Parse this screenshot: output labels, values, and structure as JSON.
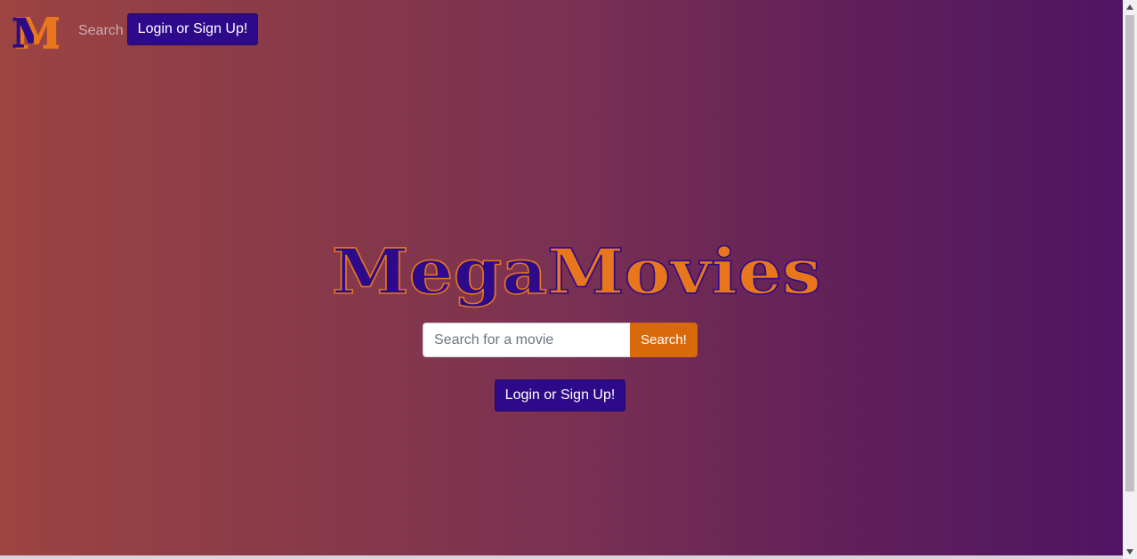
{
  "navbar": {
    "brand_letter": "M",
    "search_link": "Search",
    "login_button": "Login or Sign Up!"
  },
  "hero": {
    "logo_part1": "Mega",
    "logo_part2": "Movies",
    "search": {
      "placeholder": "Search for a movie",
      "value": "",
      "button_label": "Search!"
    },
    "login_button": "Login or Sign Up!"
  },
  "colors": {
    "brand_purple": "#2d0a8a",
    "brand_orange": "#d96a0c",
    "gradient_left": "#9d4442",
    "gradient_right": "#4f1463"
  },
  "icons": {
    "scroll_up": "triangle-up-icon",
    "scroll_down": "triangle-down-icon"
  }
}
